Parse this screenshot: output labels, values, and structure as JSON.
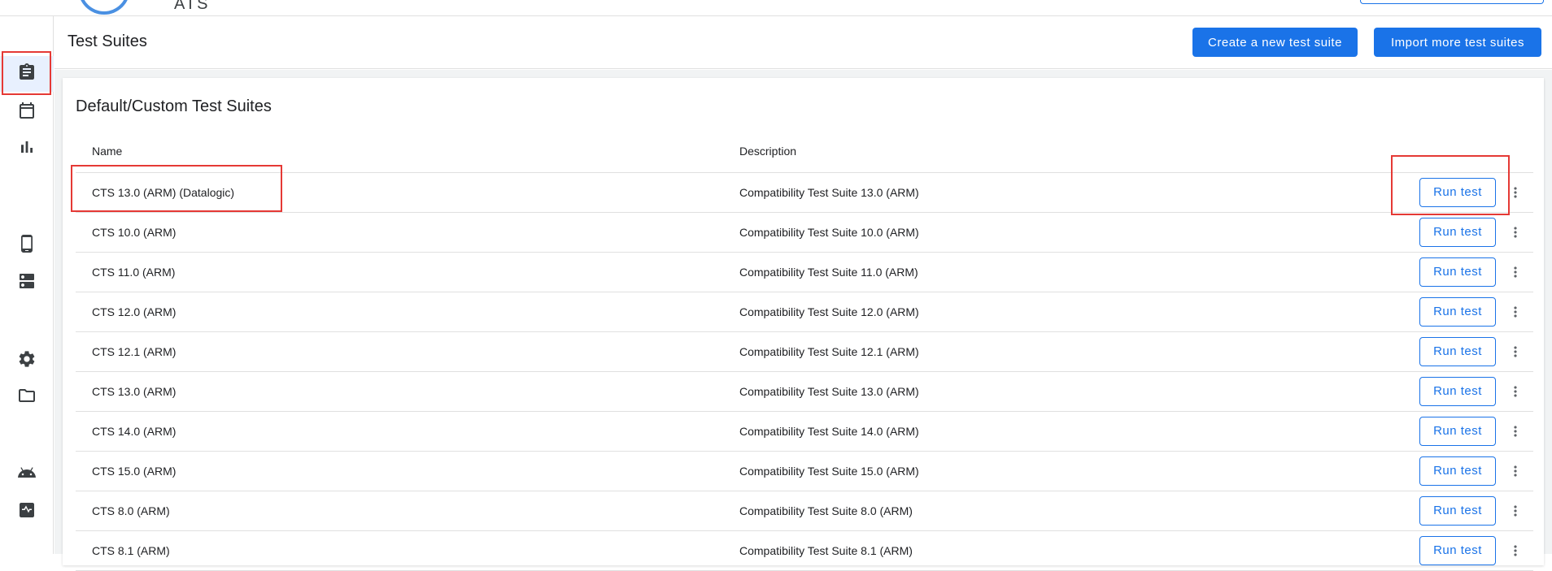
{
  "header": {
    "app_name": "ATS"
  },
  "sidebar": {
    "items": [
      {
        "icon": "clipboard-icon",
        "active": true
      },
      {
        "icon": "calendar-icon",
        "active": false
      },
      {
        "icon": "bar-chart-icon",
        "active": false
      },
      {
        "icon": "phone-icon",
        "active": false
      },
      {
        "icon": "server-icon",
        "active": false
      },
      {
        "icon": "gear-icon",
        "active": false
      },
      {
        "icon": "folder-icon",
        "active": false
      },
      {
        "icon": "android-icon",
        "active": false
      },
      {
        "icon": "pulse-icon",
        "active": false
      }
    ]
  },
  "page": {
    "title": "Test Suites",
    "create_button": "Create a new test suite",
    "import_button": "Import more test suites"
  },
  "card": {
    "title": "Default/Custom Test Suites",
    "columns": {
      "name": "Name",
      "description": "Description"
    },
    "run_label": "Run test",
    "rows": [
      {
        "name": "CTS 13.0 (ARM) (Datalogic)",
        "description": "Compatibility Test Suite 13.0 (ARM)"
      },
      {
        "name": "CTS 10.0 (ARM)",
        "description": "Compatibility Test Suite 10.0 (ARM)"
      },
      {
        "name": "CTS 11.0 (ARM)",
        "description": "Compatibility Test Suite 11.0 (ARM)"
      },
      {
        "name": "CTS 12.0 (ARM)",
        "description": "Compatibility Test Suite 12.0 (ARM)"
      },
      {
        "name": "CTS 12.1 (ARM)",
        "description": "Compatibility Test Suite 12.1 (ARM)"
      },
      {
        "name": "CTS 13.0 (ARM)",
        "description": "Compatibility Test Suite 13.0 (ARM)"
      },
      {
        "name": "CTS 14.0 (ARM)",
        "description": "Compatibility Test Suite 14.0 (ARM)"
      },
      {
        "name": "CTS 15.0 (ARM)",
        "description": "Compatibility Test Suite 15.0 (ARM)"
      },
      {
        "name": "CTS 8.0 (ARM)",
        "description": "Compatibility Test Suite 8.0 (ARM)"
      },
      {
        "name": "CTS 8.1 (ARM)",
        "description": "Compatibility Test Suite 8.1 (ARM)"
      }
    ]
  },
  "colors": {
    "primary": "#1a73e8",
    "highlight": "#e53935"
  }
}
